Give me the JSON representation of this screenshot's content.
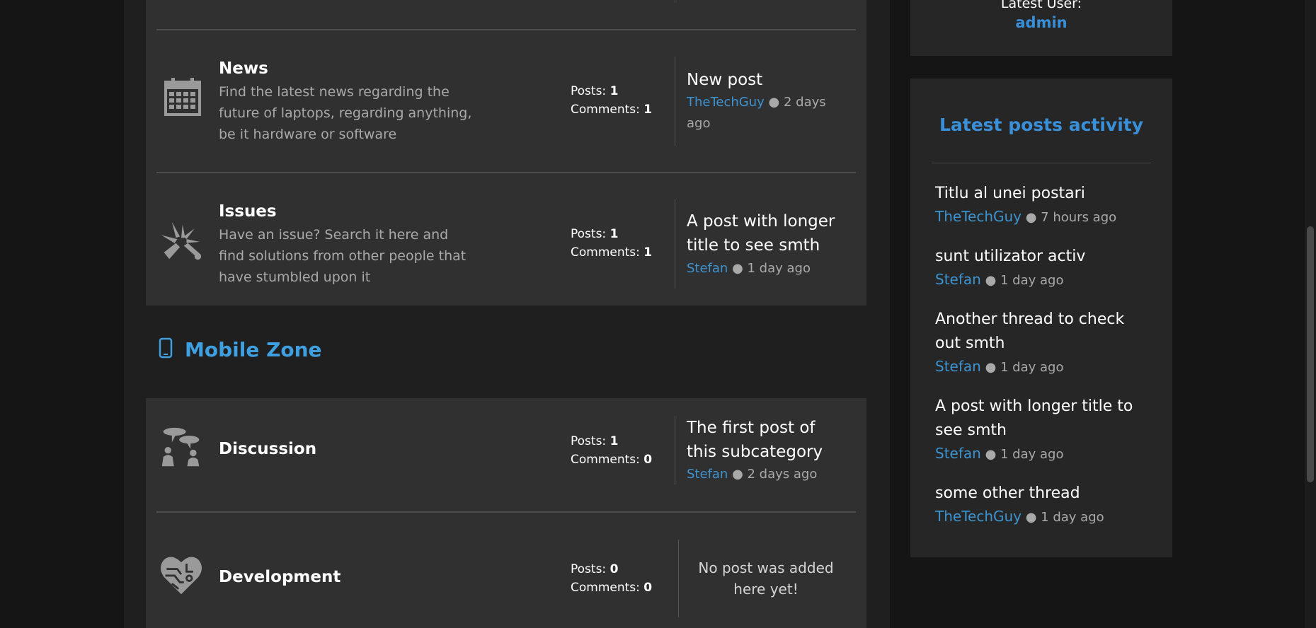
{
  "sidebar": {
    "latest_user_label": "Latest User:",
    "latest_user_name": "admin",
    "activity_heading": "Latest posts activity",
    "activity": [
      {
        "title": "Titlu al unei postari",
        "author": "TheTechGuy",
        "time": "● 7 hours ago"
      },
      {
        "title": "sunt utilizator activ",
        "author": "Stefan",
        "time": "● 1 day ago"
      },
      {
        "title": "Another thread to check out smth",
        "author": "Stefan",
        "time": "● 1 day ago"
      },
      {
        "title": "A post with longer title to see smth",
        "author": "Stefan",
        "time": "● 1 day ago"
      },
      {
        "title": "some other thread",
        "author": "TheTechGuy",
        "time": "● 1 day ago"
      }
    ]
  },
  "categories": [
    {
      "icon": "calendar-icon",
      "title": "News",
      "description": "Find the latest news regarding the future of laptops, regarding anything, be it hardware or software",
      "posts_label": "Posts:",
      "posts": "1",
      "comments_label": "Comments:",
      "comments": "1",
      "last_title": "New post",
      "last_author": "TheTechGuy",
      "last_time": "● 2 days ago"
    },
    {
      "icon": "broken-icon",
      "title": "Issues",
      "description": "Have an issue? Search it here and find solutions from other people that have stumbled upon it",
      "posts_label": "Posts:",
      "posts": "1",
      "comments_label": "Comments:",
      "comments": "1",
      "last_title": "A post with longer title to see smth",
      "last_author": "Stefan",
      "last_time": "● 1 day ago"
    }
  ],
  "mobile_zone": {
    "icon": "mobile-phone-icon",
    "title": "Mobile Zone",
    "items": [
      {
        "icon": "discussion-icon",
        "title": "Discussion",
        "posts_label": "Posts:",
        "posts": "1",
        "comments_label": "Comments:",
        "comments": "0",
        "last_title": "The first post of this subcategory",
        "last_author": "Stefan",
        "last_time": "● 2 days ago"
      },
      {
        "icon": "heart-circuit-icon",
        "title": "Development",
        "posts_label": "Posts:",
        "posts": "0",
        "comments_label": "Comments:",
        "comments": "0",
        "no_post": "No post was added here yet!"
      }
    ]
  },
  "colors": {
    "accent": "#3d93d0",
    "zone_title": "#3ea0e0",
    "panel": "#303030",
    "sidebar_panel": "#262626"
  }
}
